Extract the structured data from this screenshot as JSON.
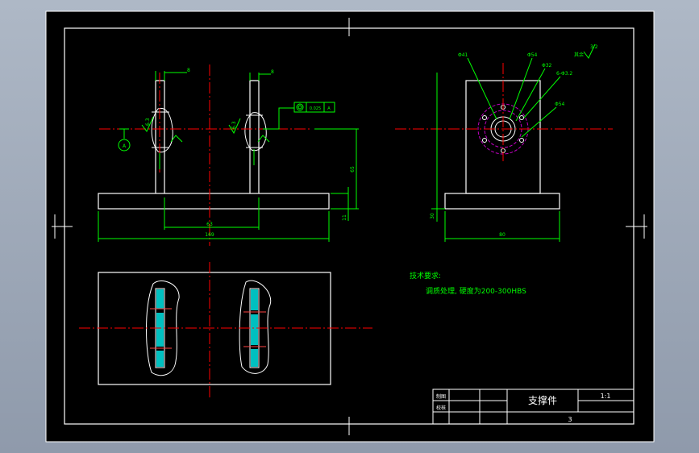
{
  "colors": {
    "background": "#000000",
    "outline": "#ffffff",
    "dimension": "#00ff00",
    "centerline": "#ff0000",
    "hatch": "#00c0c0",
    "hidden": "#c000c0",
    "frame_bg": "#aeb8c6"
  },
  "front_view": {
    "dim_total_width": "169",
    "dim_inner_width": "63",
    "dim_height": "65",
    "dim_base": "11",
    "dim_left_plate": "8",
    "dim_right_plate": "8",
    "roughness_left": "6.3",
    "roughness_right": "6.3",
    "datum_label": "A",
    "fcf_tolerance": "0.025",
    "fcf_datum": "A"
  },
  "side_view": {
    "dim_width": "80",
    "dim_base_height": "30",
    "callout_1": "Φ41",
    "callout_2": "Φ54",
    "callout_3": "Φ32",
    "callout_4": "6-Φ3.2",
    "callout_5": "Φ54",
    "other_roughness_label": "其余",
    "other_roughness_value": "3.2"
  },
  "notes": {
    "title": "技术要求:",
    "line1": "调质处理, 硬度为200-300HBS"
  },
  "title_block": {
    "part_name": "支撑件",
    "scale": "1:1",
    "label_drawn": "制图",
    "label_checked": "校核",
    "sheet_number": "3"
  }
}
